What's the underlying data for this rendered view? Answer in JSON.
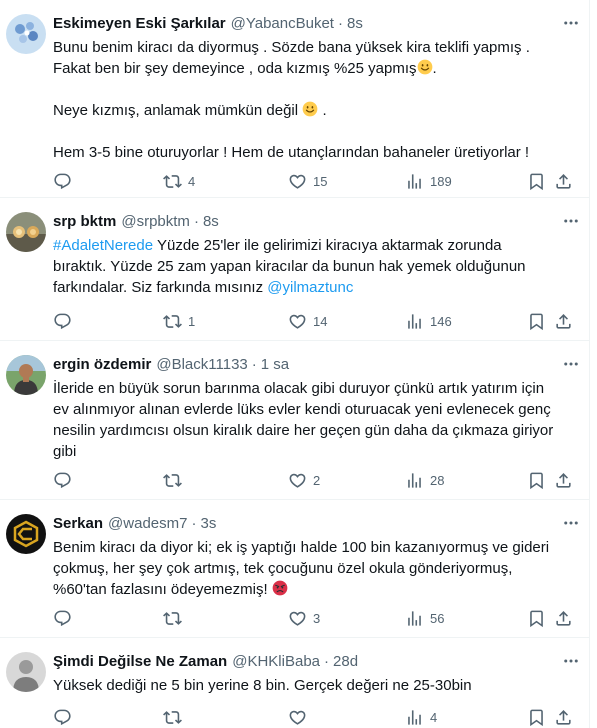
{
  "tweets": [
    {
      "name": "Eskimeyen Eski Şarkılar",
      "handle": "@YabancBuket",
      "dot": "·",
      "time": "8s",
      "lines": [
        "Bunu benim kiracı da diyormuş . Sözde bana yüksek kira teklifi yapmış .",
        "Fakat ben bir şey demeyince , oda kızmış %25 yapmış",
        "Neye kızmış, anlamak mümkün değil",
        "Hem 3-5 bine oturuyorlar ! Hem de utançlarından bahaneler üretiyorlar !"
      ],
      "line2_tail": ".",
      "line3_tail": ".",
      "reply_count": "",
      "retweet_count": "4",
      "like_count": "15",
      "view_count": "189"
    },
    {
      "name": "srp bktm",
      "handle": "@srpbktm",
      "dot": "·",
      "time": "8s",
      "hashtag": "#AdaletNerede",
      "line1_rest": " Yüzde 25'ler ile gelirimizi kiracıya aktarmak zorunda",
      "line2": "bıraktık. Yüzde 25 zam yapan kiracılar da bunun hak yemek olduğunun",
      "line3_start": "farkındalar. Siz farkında mısınız ",
      "mention": "@yilmaztunc",
      "reply_count": "",
      "retweet_count": "1",
      "like_count": "14",
      "view_count": "146"
    },
    {
      "name": "ergin özdemir",
      "handle": "@Black11133",
      "dot": "·",
      "time": "1 sa",
      "lines": [
        "İleride en büyük sorun barınma olacak gibi duruyor çünkü artık yatırım için",
        "ev alınmıyor alınan evlerde lüks evler kendi oturuacak yeni evlenecek genç",
        "nesilin yardımcısı olsun kiralık daire her geçen gün daha da çıkmaza giriyor",
        "gibi"
      ],
      "reply_count": "",
      "retweet_count": "",
      "like_count": "2",
      "view_count": "28"
    },
    {
      "name": "Serkan",
      "handle": "@wadesm7",
      "dot": "·",
      "time": "3s",
      "lines": [
        "Benim kiracı da diyor ki; ek iş yaptığı halde 100 bin kazanıyormuş ve gideri",
        "çokmuş, her şey çok artmış, tek çocuğunu özel okula gönderiyormuş,",
        "%60'tan fazlasını ödeyemezmiş!"
      ],
      "reply_count": "",
      "retweet_count": "",
      "like_count": "3",
      "view_count": "56"
    },
    {
      "name": "Şimdi Değilse Ne Zaman",
      "handle": "@KHKliBaba",
      "dot": "·",
      "time": "28d",
      "lines": [
        "Yüksek dediği ne 5 bin yerine 8 bin. Gerçek değeri ne 25-30bin"
      ],
      "reply_count": "",
      "retweet_count": "",
      "like_count": "",
      "view_count": "4"
    }
  ],
  "colors": {
    "text": "#0f1419",
    "secondary": "#536471",
    "link": "#1d9bf0",
    "divider": "#eff3f4"
  },
  "icons": [
    "reply-icon",
    "retweet-icon",
    "like-icon",
    "views-icon",
    "bookmark-icon",
    "share-icon",
    "more-icon",
    "smile-emoji",
    "angry-emoji"
  ]
}
